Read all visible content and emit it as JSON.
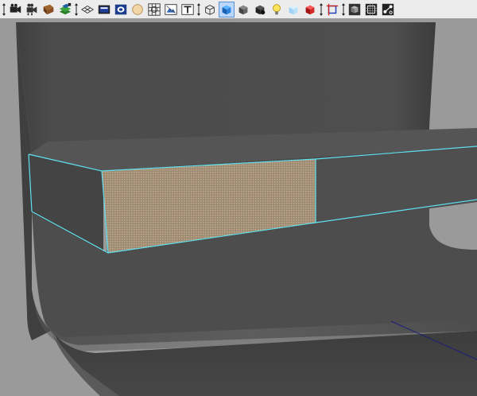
{
  "toolbar": {
    "groups": [
      [
        "select-camera-icon",
        "tumble-camera-icon",
        "book-icon",
        "layers-icon"
      ],
      [
        "wireframe-grid-icon",
        "film-strip-icon",
        "shaded-sphere-icon",
        "sphere-icon",
        "xray-grid-icon",
        "texture-map-icon",
        "text-t-icon"
      ],
      [
        "cube-wire-icon",
        "cube-smooth-shaded-icon",
        "cube-shaded-icon",
        "cube-dark-icon",
        "lightbulb-icon",
        "ice-cube-icon",
        "red-cube-icon"
      ],
      [
        "transform-frame-icon"
      ],
      [
        "isolate-cube-icon",
        "grid-box-icon",
        "node-graph-icon"
      ]
    ],
    "active": [
      "cube-smooth-shaded-icon"
    ]
  },
  "viewport": {
    "background": "#9a9a9a",
    "mesh_color": "#4a4a4a",
    "highlight_color": "#5fe0f0",
    "selected_face_color": "#b49a7c"
  }
}
